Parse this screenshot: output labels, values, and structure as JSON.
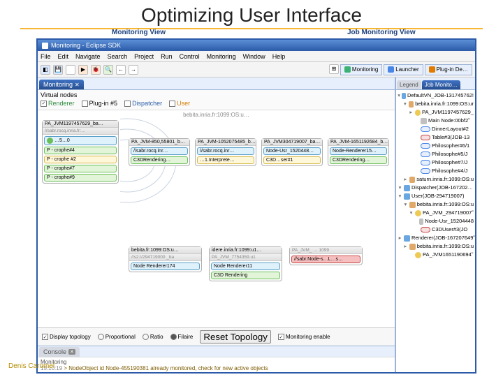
{
  "slide": {
    "title": "Optimizing User Interface"
  },
  "annot": {
    "monitoring_view": "Monitoring View",
    "job_view": "Job Monitoring View"
  },
  "window": {
    "title": "Monitoring - Eclipse SDK"
  },
  "menu": [
    "File",
    "Edit",
    "Navigate",
    "Search",
    "Project",
    "Run",
    "Control",
    "Monitoring",
    "Window",
    "Help"
  ],
  "perspectives": {
    "switch_hint": "",
    "items": [
      {
        "label": "Monitoring"
      },
      {
        "label": "Launcher"
      },
      {
        "label": "Plug-in De…"
      }
    ]
  },
  "left_view": {
    "tab": "Monitoring",
    "vn_title": "Virtual nodes",
    "checks": [
      {
        "label": "Renderer",
        "on": true,
        "cls": "lbl-green"
      },
      {
        "label": "Plug-in #5",
        "on": false,
        "cls": ""
      },
      {
        "label": "Dispatcher",
        "on": false,
        "cls": "lbl-blue"
      },
      {
        "label": "User",
        "on": false,
        "cls": "lbl-orange"
      }
    ],
    "canvas_header": "bebita.inria.fr:1099:OS:u…"
  },
  "hosts": {
    "h1": {
      "hdr": "PA_JVM1197457629_ba…",
      "sub": "//sabr.rocq.inria.fr:…"
    },
    "h1_slots": [
      {
        "cls": "blue",
        "dot": "green",
        "t": "…5…0"
      },
      {
        "cls": "green",
        "dot": "",
        "t": "P - crophe#4"
      },
      {
        "cls": "yellow",
        "dot": "",
        "t": "P - crophe #2"
      },
      {
        "cls": "green",
        "dot": "",
        "t": "P - crophe#7"
      },
      {
        "cls": "green",
        "dot": "",
        "t": "P - crophe#9"
      }
    ],
    "row": [
      {
        "hdr": "PA_JVM-850,55801_b…",
        "slots": [
          {
            "cls": "blue",
            "t": "//sabr.rocq.inr…"
          },
          {
            "cls": "green",
            "t": "C3DRendering…"
          }
        ]
      },
      {
        "hdr": "PA_JVM-1052075485_b…",
        "slots": [
          {
            "cls": "blue",
            "t": "//sabr.rocq.inr…"
          },
          {
            "cls": "yellow",
            "t": "…1.Interprete…"
          }
        ]
      },
      {
        "hdr": "PA_JVM304719007_ba…",
        "slots": [
          {
            "cls": "blue",
            "t": "Node-Usr_1520448…"
          },
          {
            "cls": "yellow",
            "t": "C3D…ser#1"
          }
        ]
      },
      {
        "hdr": "PA_JVM-1651192684_b…",
        "slots": [
          {
            "cls": "blue",
            "t": "Node-Renderer15…"
          },
          {
            "cls": "green",
            "t": "C3DRendering…"
          }
        ]
      }
    ],
    "brow": [
      {
        "hdr": "bebita.fr:1099:OS:u…",
        "sub": "//s2://294719000 _ba",
        "slots": [
          {
            "cls": "blue",
            "t": "Node Renderer174"
          }
        ]
      },
      {
        "hdr": "idere.inria.fr:1099:u1…",
        "sub": "PA_JVM_7754359.u1",
        "slots": [
          {
            "cls": "blue",
            "t": "Node Renderer11"
          },
          {
            "cls": "green",
            "t": "C3D Rendering"
          }
        ]
      },
      {
        "hdr": "",
        "sub": "PA_JVM_ … 1099",
        "slots": [
          {
            "cls": "red",
            "t": "//sabr.Node-s…L…s…"
          }
        ]
      }
    ]
  },
  "bottom_ctrl": {
    "display_topology": "Display topology",
    "proportional": "Proportional",
    "ratio": "Ratio",
    "filaire": "Filaire",
    "reset": "Reset Topology",
    "monitoring_enable": "Monitoring enable"
  },
  "console": {
    "tab": "Console",
    "title": "Monitoring",
    "line": "> NodeObject id Node-455190381 already monitored, check for new active objects",
    "ts": "15:10:19"
  },
  "right_view": {
    "tabs": [
      "Legend",
      "Job Monito…"
    ],
    "tree": [
      {
        "ind": 0,
        "tw": "▾",
        "ic": "globe",
        "t": "DefaultVN_JOB-131745762!"
      },
      {
        "ind": 1,
        "tw": "▾",
        "ic": "host",
        "t": "bebita.inria.fr:1099:OS:ur"
      },
      {
        "ind": 2,
        "tw": "▸",
        "ic": "vm",
        "t": "PA_JVM1197457629_"
      },
      {
        "ind": 3,
        "tw": "",
        "ic": "node",
        "t": "Main Node:00bf2̃"
      },
      {
        "ind": 3,
        "tw": "",
        "ov": "blue",
        "t": "DinnerLayout#2"
      },
      {
        "ind": 3,
        "tw": "",
        "ov": "red",
        "t": "Table#3(JOB-13"
      },
      {
        "ind": 3,
        "tw": "",
        "ov": "blue",
        "t": "Philosopher#6/1"
      },
      {
        "ind": 3,
        "tw": "",
        "ov": "blue",
        "t": "Philosophe#5/J"
      },
      {
        "ind": 3,
        "tw": "",
        "ov": "blue",
        "t": "Philosophe#7/J"
      },
      {
        "ind": 3,
        "tw": "",
        "ov": "blue",
        "t": "Philosophe#4/J"
      },
      {
        "ind": 1,
        "tw": "▸",
        "ic": "host",
        "t": "saturn.inria.fr:1099:OS:u"
      },
      {
        "ind": 0,
        "tw": "▾",
        "ic": "globe",
        "t": "Dispatcher(JOB-167202…"
      },
      {
        "ind": 0,
        "tw": "▾",
        "ic": "globe",
        "t": "User(JOB-294719007)"
      },
      {
        "ind": 1,
        "tw": "▾",
        "ic": "host",
        "t": "bebita.inria.fr:1099:OS:u"
      },
      {
        "ind": 2,
        "tw": "▾",
        "ic": "vm",
        "t": "PA_JVM_294719007̃"
      },
      {
        "ind": 3,
        "tw": "",
        "ic": "node",
        "t": "Node-Usr_15204448"
      },
      {
        "ind": 3,
        "tw": "",
        "ov": "red",
        "t": "C3DUser#3(JO"
      },
      {
        "ind": 0,
        "tw": "▸",
        "ic": "globe",
        "t": "Renderer(JOB-167207649̃"
      },
      {
        "ind": 1,
        "tw": "▸",
        "ic": "host",
        "t": "bebita.inria.fr:1099:OS:u"
      },
      {
        "ind": 2,
        "tw": "",
        "ic": "vm",
        "t": "PA_JVM1651190694̃"
      }
    ]
  },
  "footer": {
    "author": "Denis Caromel"
  }
}
